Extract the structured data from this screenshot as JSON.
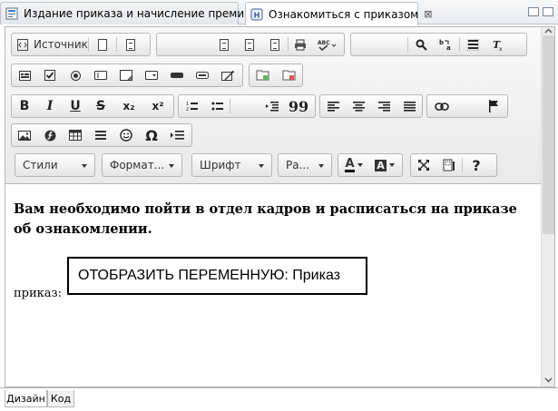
{
  "tabs": [
    {
      "label": "Издание приказа и начисление премии",
      "active": false
    },
    {
      "label": "Ознакомиться с приказом",
      "active": true,
      "close": "⊠"
    }
  ],
  "toolbar": {
    "source_label": "Источник",
    "styles_label": "Стили",
    "format_label": "Формат...",
    "font_label": "Шрифт",
    "size_label": "Ра...",
    "bold": "B",
    "italic": "I",
    "underline": "U",
    "strike": "S",
    "subscript": "x₂",
    "superscript": "x²",
    "quote": "99",
    "omega": "Ω",
    "help": "?",
    "text_color_letter": "A",
    "bg_color_letter": "A"
  },
  "content": {
    "paragraph": "Вам необходимо пойти в отдел кадров и расписаться на приказе об ознакомлении.",
    "inline_label": "приказ:",
    "variable_box": "ОТОБРАЗИТЬ ПЕРЕМЕННУЮ: Приказ"
  },
  "bottom_tabs": [
    {
      "label": "Дизайн",
      "selected": true
    },
    {
      "label": "Код",
      "selected": false
    }
  ]
}
